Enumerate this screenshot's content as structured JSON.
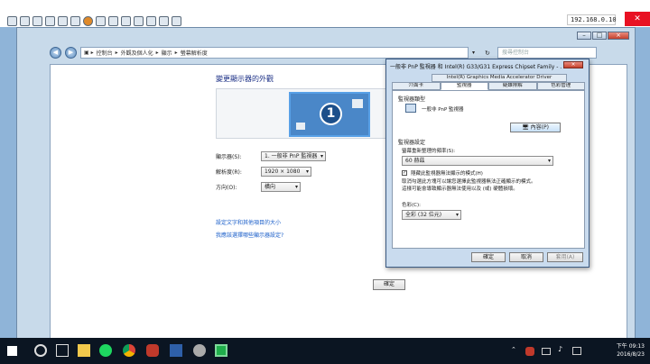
{
  "viewer": {
    "ip_address": "192.168.0.10",
    "close_label": "✕"
  },
  "explorer": {
    "breadcrumb": [
      "控制台",
      "外觀及個人化",
      "顯示",
      "螢幕解析度"
    ],
    "search_placeholder": "搜尋控制台"
  },
  "control_panel": {
    "title": "變更顯示器的外觀",
    "monitor_number": "1",
    "display_label": "顯示器(S):",
    "display_value": "1. 一般非 PnP 監視器",
    "resolution_label": "解析度(R):",
    "resolution_value": "1920 × 1080",
    "orientation_label": "方向(O):",
    "orientation_value": "橫向",
    "link1": "設定文字和其他項目的大小",
    "link2": "我應該選擇哪些顯示器設定?",
    "ok_label": "確定"
  },
  "dialog": {
    "title": "一般非 PnP 監視器 和 Intel(R) G33/G31 Express Chipset Family - ...",
    "tab_top": "Intel(R) Graphics Media Accelerator Driver",
    "tabs": [
      "介面卡",
      "監視器",
      "疑難排解",
      "色彩管理"
    ],
    "monitor_type_heading": "監視器類型",
    "monitor_type_value": "一般非 PnP 監視器",
    "properties_button": "內容(P)",
    "settings_heading": "監視器設定",
    "refresh_label": "螢幕重新整理的頻率(S):",
    "refresh_value": "60 赫茲",
    "hide_modes_label": "隱藏此監視器無法顯示的模式(H)",
    "warning_line1": "取消勾選此方塊可以讓您選擇此監視器無法正確顯示的模式。",
    "warning_line2": "這樣可能會導致顯示器無法使用以及 (或) 硬體損壞。",
    "color_label": "色彩(C):",
    "color_value": "全彩 (32 位元)",
    "ok_button": "確定",
    "cancel_button": "取消",
    "apply_button": "套用(A)"
  },
  "taskbar": {
    "time": "下午 09:13",
    "date": "2016/8/23"
  }
}
